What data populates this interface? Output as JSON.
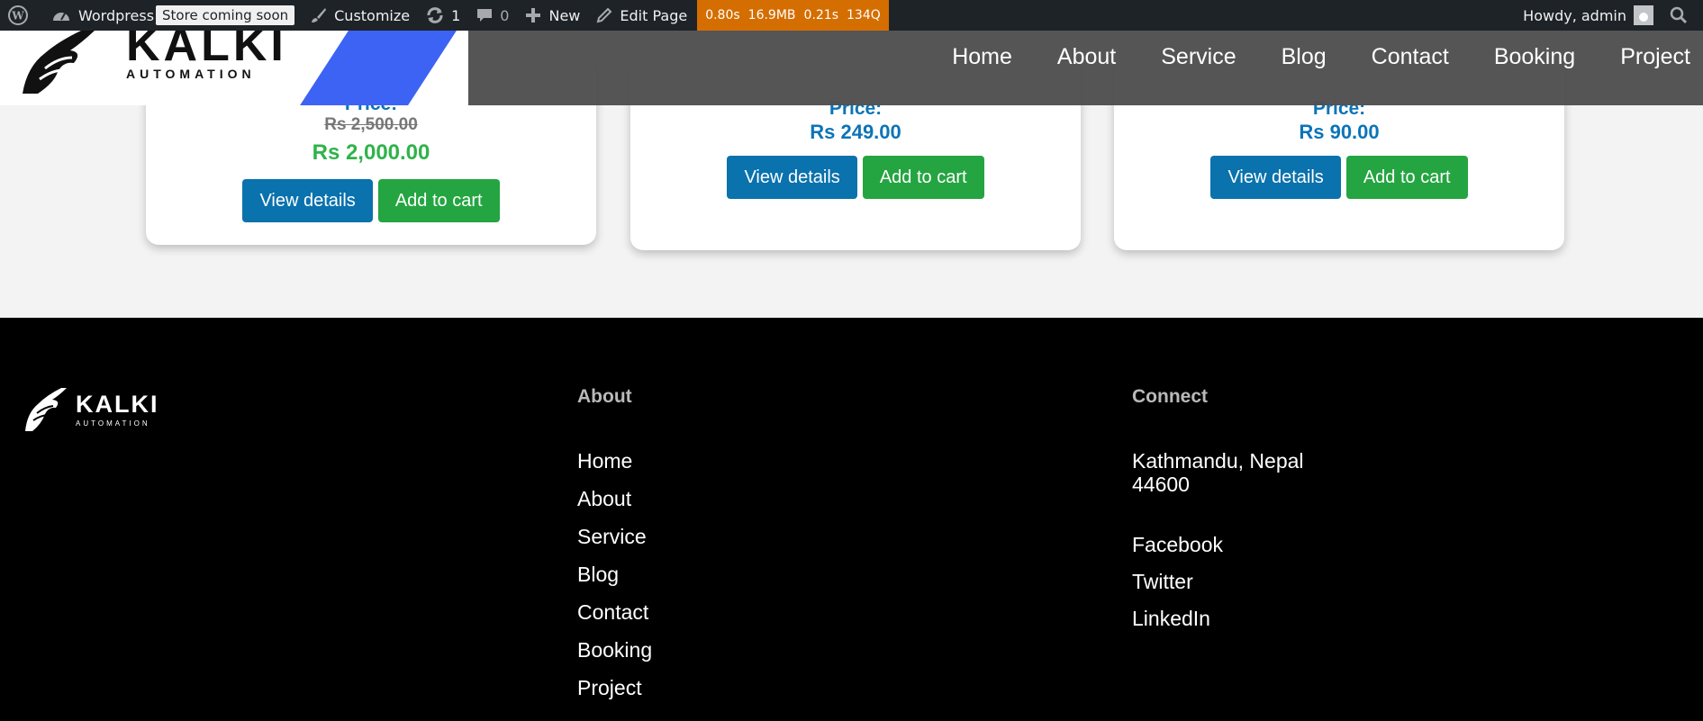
{
  "admin_bar": {
    "site_name": "Wordpress",
    "store_badge": "Store coming soon",
    "customize": "Customize",
    "updates_count": "1",
    "comments_count": "0",
    "new_label": "New",
    "edit_page": "Edit Page",
    "perf": [
      "0.80s",
      "16.9MB",
      "0.21s",
      "134Q"
    ],
    "howdy": "Howdy, admin"
  },
  "header": {
    "logo_text": "KALKI",
    "logo_sub": "AUTOMATION",
    "nav": [
      "Home",
      "About",
      "Service",
      "Blog",
      "Contact",
      "Booking",
      "Project"
    ]
  },
  "products": [
    {
      "price_label": "Price:",
      "old_price": "Rs 2,500.00",
      "sale_price": "Rs 2,000.00",
      "view": "View details",
      "cart": "Add to cart"
    },
    {
      "price_label": "Price:",
      "price": "Rs 249.00",
      "view": "View details",
      "cart": "Add to cart"
    },
    {
      "price_label": "Price:",
      "price": "Rs 90.00",
      "view": "View details",
      "cart": "Add to cart"
    }
  ],
  "footer": {
    "logo_text": "KALKI",
    "logo_sub": "AUTOMATION",
    "about_heading": "About",
    "about_links": [
      "Home",
      "About",
      "Service",
      "Blog",
      "Contact",
      "Booking",
      "Project"
    ],
    "connect_heading": "Connect",
    "address_line1": "Kathmandu, Nepal",
    "address_line2": "44600",
    "social": [
      "Facebook",
      "Twitter",
      "LinkedIn"
    ]
  },
  "colors": {
    "admin_bar": "#1d2327",
    "perf_bg": "#d56e00",
    "accent_stripe": "#3d63f5",
    "button_blue": "#0a72ad",
    "button_green": "#24a541",
    "price_blue": "#0b74b8",
    "sale_green": "#2fb34a"
  }
}
